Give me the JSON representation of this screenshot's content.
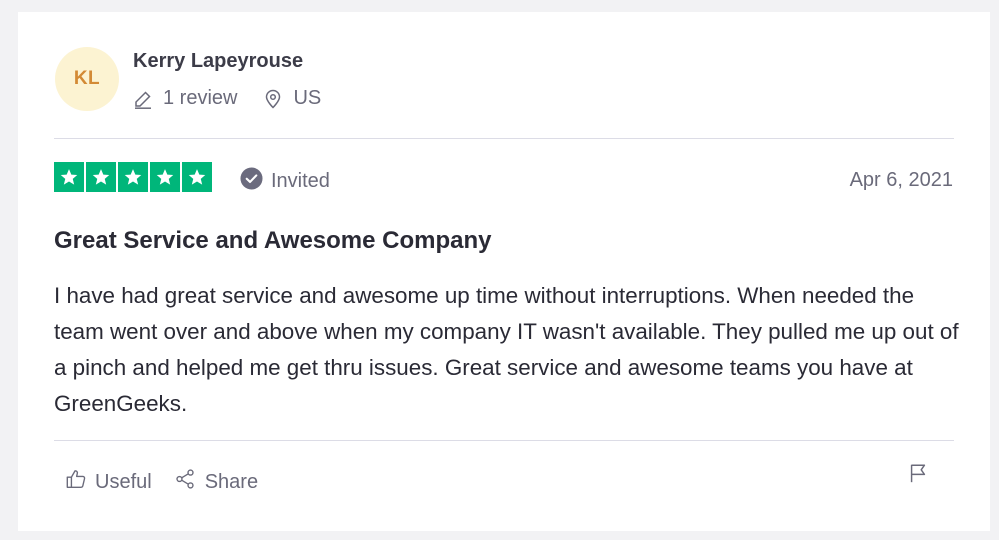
{
  "reviewer": {
    "initials": "KL",
    "name": "Kerry Lapeyrouse",
    "review_count": "1 review",
    "country": "US"
  },
  "review": {
    "rating": 5,
    "invited_label": "Invited",
    "date": "Apr 6, 2021",
    "title": "Great Service and Awesome Company",
    "body": "I have had great service and awesome up time without interruptions. When needed the team went over and above when my company IT wasn't available. They pulled me up out of a pinch and helped me get thru issues. Great service and awesome teams you have at GreenGeeks."
  },
  "actions": {
    "useful_label": "Useful",
    "share_label": "Share"
  },
  "colors": {
    "star_green": "#00b67a",
    "avatar_bg": "#fcf3d2",
    "avatar_text": "#d38a35"
  },
  "icons": [
    "pencil-icon",
    "location-pin-icon",
    "check-badge-icon",
    "star-icon",
    "thumbs-up-icon",
    "share-icon",
    "flag-icon"
  ]
}
